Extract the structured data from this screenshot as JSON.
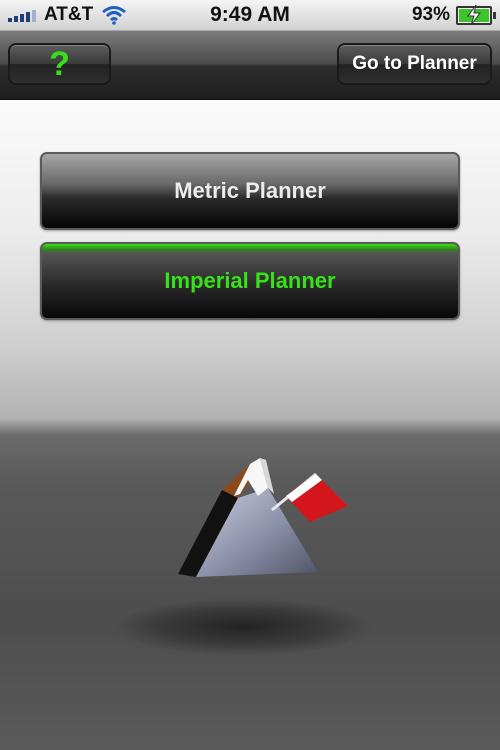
{
  "status_bar": {
    "carrier": "AT&T",
    "time": "9:49 AM",
    "battery_percent": "93",
    "percent_sign": "%",
    "signal_icon": "signal-bars-icon",
    "wifi_icon": "wifi-icon",
    "battery_icon": "battery-charging-icon"
  },
  "nav_bar": {
    "help_label": "?",
    "planner_label": "Go to Planner"
  },
  "main": {
    "metric_label": "Metric Planner",
    "imperial_label": "Imperial Planner",
    "selected": "imperial",
    "accent_color": "#36e218",
    "logo_icon": "mountain-flag-logo"
  }
}
